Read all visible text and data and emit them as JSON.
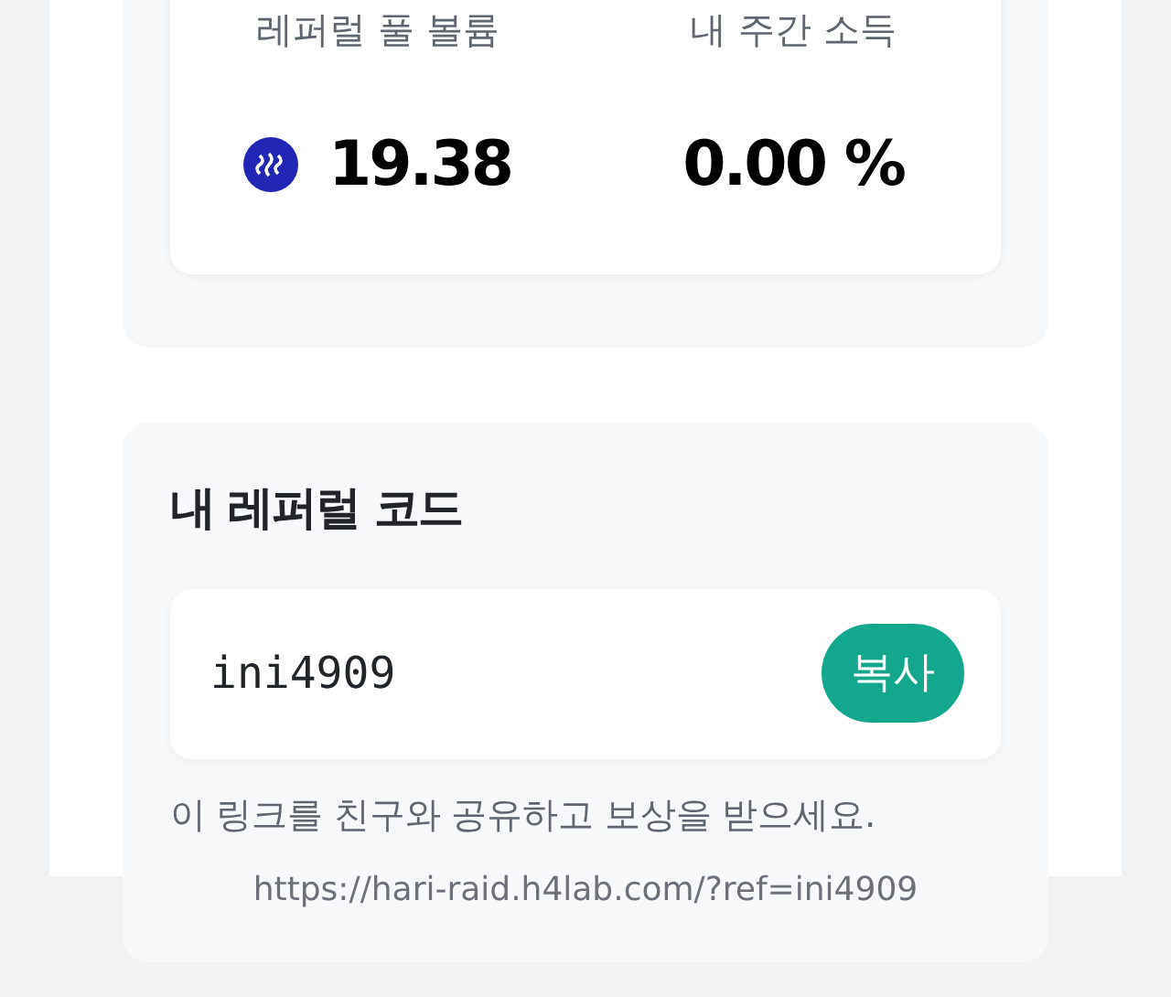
{
  "stats": [
    {
      "label": "레퍼럴 풀 볼륨",
      "value": "19.38",
      "kind": "coin"
    },
    {
      "label": "내 주간 소득",
      "value": "0.00 %",
      "kind": "plain"
    }
  ],
  "referral": {
    "title": "내 레퍼럴 코드",
    "code": "ini4909",
    "copy_button": "복사",
    "description": "이 링크를 친구와 공유하고 보상을 받으세요.",
    "link": "https://hari-raid.h4lab.com/?ref=ini4909"
  }
}
